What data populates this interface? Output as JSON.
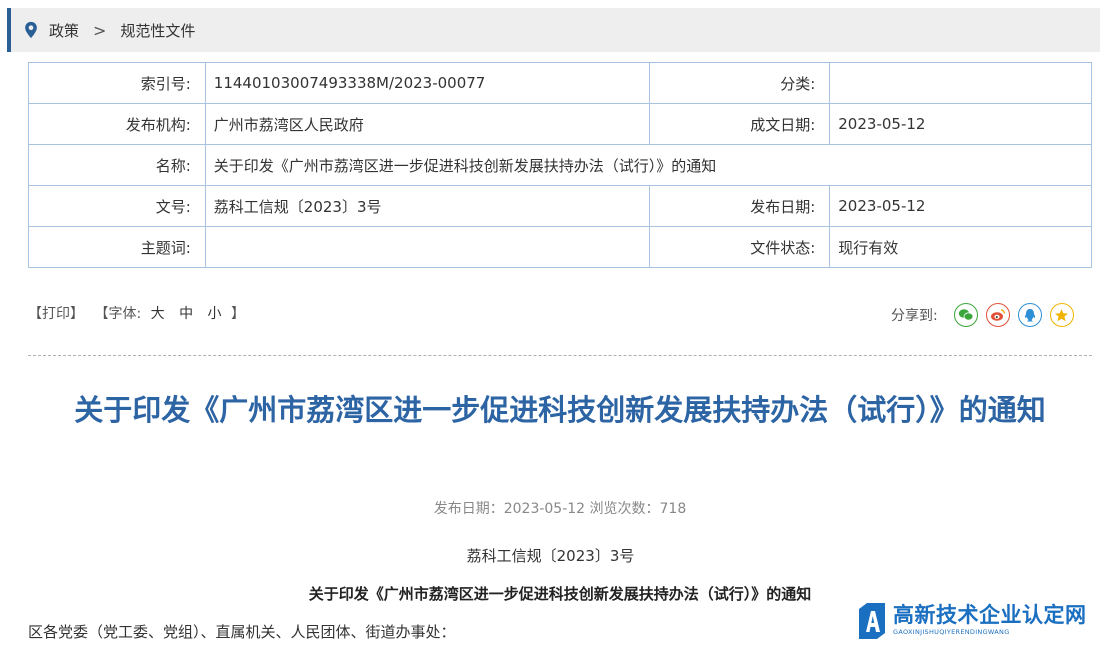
{
  "breadcrumb": {
    "items": [
      "政策",
      "规范性文件"
    ],
    "separator": ">"
  },
  "info": {
    "index_label": "索引号:",
    "index_value": "11440103007493338M/2023-00077",
    "category_label": "分类:",
    "category_value": "",
    "issuer_label": "发布机构:",
    "issuer_value": "广州市荔湾区人民政府",
    "written_date_label": "成文日期:",
    "written_date_value": "2023-05-12",
    "name_label": "名称:",
    "name_value": "关于印发《广州市荔湾区进一步促进科技创新发展扶持办法（试行）》的通知",
    "doc_no_label": "文号:",
    "doc_no_value": "荔科工信规〔2023〕3号",
    "publish_date_label": "发布日期:",
    "publish_date_value": "2023-05-12",
    "keywords_label": "主题词:",
    "keywords_value": "",
    "status_label": "文件状态:",
    "status_value": "现行有效"
  },
  "tools": {
    "print": "【打印】",
    "font_prefix": "【字体:",
    "font_large": "大",
    "font_medium": "中",
    "font_small": "小",
    "font_suffix": "】",
    "share_label": "分享到:"
  },
  "share_icons": [
    "wechat-icon",
    "weibo-icon",
    "qq-icon",
    "qzone-icon"
  ],
  "article": {
    "title": "关于印发《广州市荔湾区进一步促进科技创新发展扶持办法（试行）》的通知",
    "meta": "发布日期：2023-05-12  浏览次数：718",
    "doc_no": "荔科工信规〔2023〕3号",
    "subtitle": "关于印发《广州市荔湾区进一步促进科技创新发展扶持办法（试行）》的通知",
    "first_paragraph": "区各党委（党工委、党组）、直属机关、人民团体、街道办事处："
  },
  "watermark": {
    "main": "高新技术企业认定网",
    "sub": "GAOXINJISHUQIYERENDINGWANG"
  },
  "colors": {
    "accent": "#2d64a4",
    "border": "#a8c3df",
    "crumb_bg": "#eeeeee",
    "wechat": "#3aa63a",
    "weibo": "#e0503a",
    "qq": "#2d8fd5",
    "qzone": "#f0b400"
  }
}
